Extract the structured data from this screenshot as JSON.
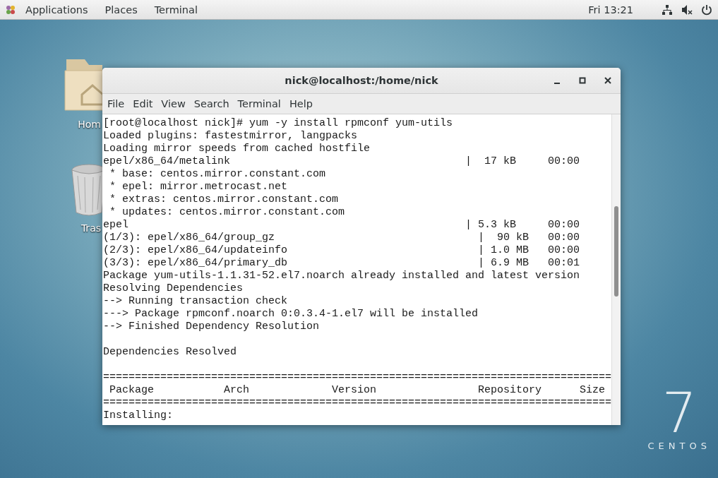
{
  "top_bar": {
    "menus": [
      "Applications",
      "Places",
      "Terminal"
    ],
    "clock": "Fri 13:21"
  },
  "desktop_icons": [
    {
      "kind": "folder",
      "label": "Hom"
    },
    {
      "kind": "trash",
      "label": "Tras"
    }
  ],
  "window": {
    "title": "nick@localhost:/home/nick",
    "menu": [
      "File",
      "Edit",
      "View",
      "Search",
      "Terminal",
      "Help"
    ],
    "lines": [
      {
        "kind": "text",
        "text": "[root@localhost nick]# yum -y install rpmconf yum-utils"
      },
      {
        "kind": "text",
        "text": "Loaded plugins: fastestmirror, langpacks"
      },
      {
        "kind": "text",
        "text": "Loading mirror speeds from cached hostfile"
      },
      {
        "kind": "text",
        "text": "epel/x86_64/metalink                                     |  17 kB     00:00"
      },
      {
        "kind": "text",
        "text": " * base: centos.mirror.constant.com"
      },
      {
        "kind": "text",
        "text": " * epel: mirror.metrocast.net"
      },
      {
        "kind": "text",
        "text": " * extras: centos.mirror.constant.com"
      },
      {
        "kind": "text",
        "text": " * updates: centos.mirror.constant.com"
      },
      {
        "kind": "text",
        "text": "epel                                                     | 5.3 kB     00:00"
      },
      {
        "kind": "text",
        "text": "(1/3): epel/x86_64/group_gz                                |  90 kB   00:00"
      },
      {
        "kind": "text",
        "text": "(2/3): epel/x86_64/updateinfo                              | 1.0 MB   00:00"
      },
      {
        "kind": "text",
        "text": "(3/3): epel/x86_64/primary_db                              | 6.9 MB   00:01"
      },
      {
        "kind": "text",
        "text": "Package yum-utils-1.1.31-52.el7.noarch already installed and latest version"
      },
      {
        "kind": "text",
        "text": "Resolving Dependencies"
      },
      {
        "kind": "text",
        "text": "--> Running transaction check"
      },
      {
        "kind": "text",
        "text": "---> Package rpmconf.noarch 0:0.3.4-1.el7 will be installed"
      },
      {
        "kind": "text",
        "text": "--> Finished Dependency Resolution"
      },
      {
        "kind": "blank"
      },
      {
        "kind": "text",
        "text": "Dependencies Resolved"
      },
      {
        "kind": "blank"
      },
      {
        "kind": "text",
        "text": "================================================================================"
      },
      {
        "kind": "text",
        "text": " Package           Arch             Version                Repository      Size"
      },
      {
        "kind": "text",
        "text": "================================================================================"
      },
      {
        "kind": "text",
        "text": "Installing:"
      }
    ]
  },
  "logo": {
    "number": "7",
    "name": "CENTOS"
  }
}
